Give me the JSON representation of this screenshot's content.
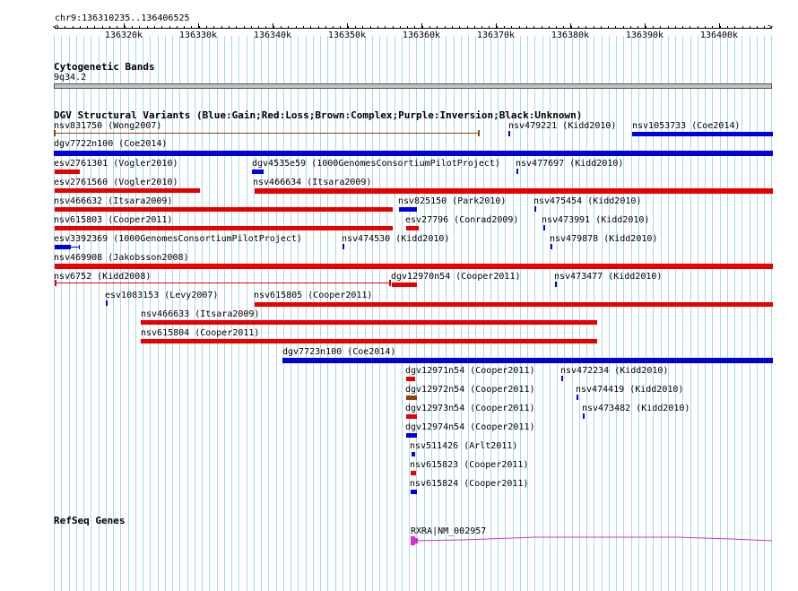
{
  "ruler": {
    "location": "chr9:136310235..136406525",
    "ticks": [
      "136320k",
      "136330k",
      "136340k",
      "136350k",
      "136360k",
      "136370k",
      "136380k",
      "136390k",
      "136400k"
    ]
  },
  "cytoband": {
    "title": "Cytogenetic Bands",
    "band": "9q34.2"
  },
  "dgv": {
    "title": "DGV Structural Variants (Blue:Gain;Red:Loss;Brown:Complex;Purple:Inversion;Black:Unknown)",
    "features": [
      {
        "label": "nsv831750 (Wong2007)",
        "type": "loss-line"
      },
      {
        "label": "nsv479221 (Kidd2010)",
        "type": "gain"
      },
      {
        "label": "nsv1053733 (Coe2014)",
        "type": "gain"
      },
      {
        "label": "dgv7722n100 (Coe2014)",
        "type": "gain"
      },
      {
        "label": "esv2761301 (Vogler2010)",
        "type": "loss"
      },
      {
        "label": "dgv4535e59 (1000GenomesConsortiumPilotProject)",
        "type": "gain"
      },
      {
        "label": "nsv477697 (Kidd2010)",
        "type": "gain"
      },
      {
        "label": "esv2761560 (Vogler2010)",
        "type": "loss"
      },
      {
        "label": "nsv466634 (Itsara2009)",
        "type": "loss"
      },
      {
        "label": "nsv466632 (Itsara2009)",
        "type": "loss"
      },
      {
        "label": "nsv825150 (Park2010)",
        "type": "gain"
      },
      {
        "label": "nsv475454 (Kidd2010)",
        "type": "gain"
      },
      {
        "label": "nsv615803 (Cooper2011)",
        "type": "loss"
      },
      {
        "label": "esv27796 (Conrad2009)",
        "type": "loss"
      },
      {
        "label": "nsv473991 (Kidd2010)",
        "type": "gain"
      },
      {
        "label": "esv3392369 (1000GenomesConsortiumPilotProject)",
        "type": "gain"
      },
      {
        "label": "nsv474530 (Kidd2010)",
        "type": "gain"
      },
      {
        "label": "nsv479878 (Kidd2010)",
        "type": "gain"
      },
      {
        "label": "nsv469908 (Jakobsson2008)",
        "type": "loss"
      },
      {
        "label": "nsv6752 (Kidd2008)",
        "type": "loss-line"
      },
      {
        "label": "dgv12970n54 (Cooper2011)",
        "type": "loss"
      },
      {
        "label": "nsv473477 (Kidd2010)",
        "type": "gain"
      },
      {
        "label": "esv1083153 (Levy2007)",
        "type": "gain"
      },
      {
        "label": "nsv615805 (Cooper2011)",
        "type": "loss"
      },
      {
        "label": "nsv466633 (Itsara2009)",
        "type": "loss"
      },
      {
        "label": "nsv615804 (Cooper2011)",
        "type": "loss"
      },
      {
        "label": "dgv7723n100 (Coe2014)",
        "type": "gain"
      },
      {
        "label": "dgv12971n54 (Cooper2011)",
        "type": "loss"
      },
      {
        "label": "nsv472234 (Kidd2010)",
        "type": "gain"
      },
      {
        "label": "dgv12972n54 (Cooper2011)",
        "type": "complex"
      },
      {
        "label": "nsv474419 (Kidd2010)",
        "type": "gain"
      },
      {
        "label": "dgv12973n54 (Cooper2011)",
        "type": "loss"
      },
      {
        "label": "nsv473482 (Kidd2010)",
        "type": "gain"
      },
      {
        "label": "dgv12974n54 (Cooper2011)",
        "type": "gain"
      },
      {
        "label": "nsv511426 (Arlt2011)",
        "type": "gain"
      },
      {
        "label": "nsv615823 (Cooper2011)",
        "type": "loss"
      },
      {
        "label": "nsv615824 (Cooper2011)",
        "type": "gain"
      }
    ]
  },
  "refseq": {
    "title": "RefSeq Genes",
    "gene_label": "RXRA|NM_002957"
  },
  "colors": {
    "gain": "#0000dd",
    "loss": "#e80000",
    "complex": "#8b4513",
    "gene": "#cc33cc",
    "gridline": "#a8d8e8",
    "cytoband": "#c0c0c0"
  }
}
